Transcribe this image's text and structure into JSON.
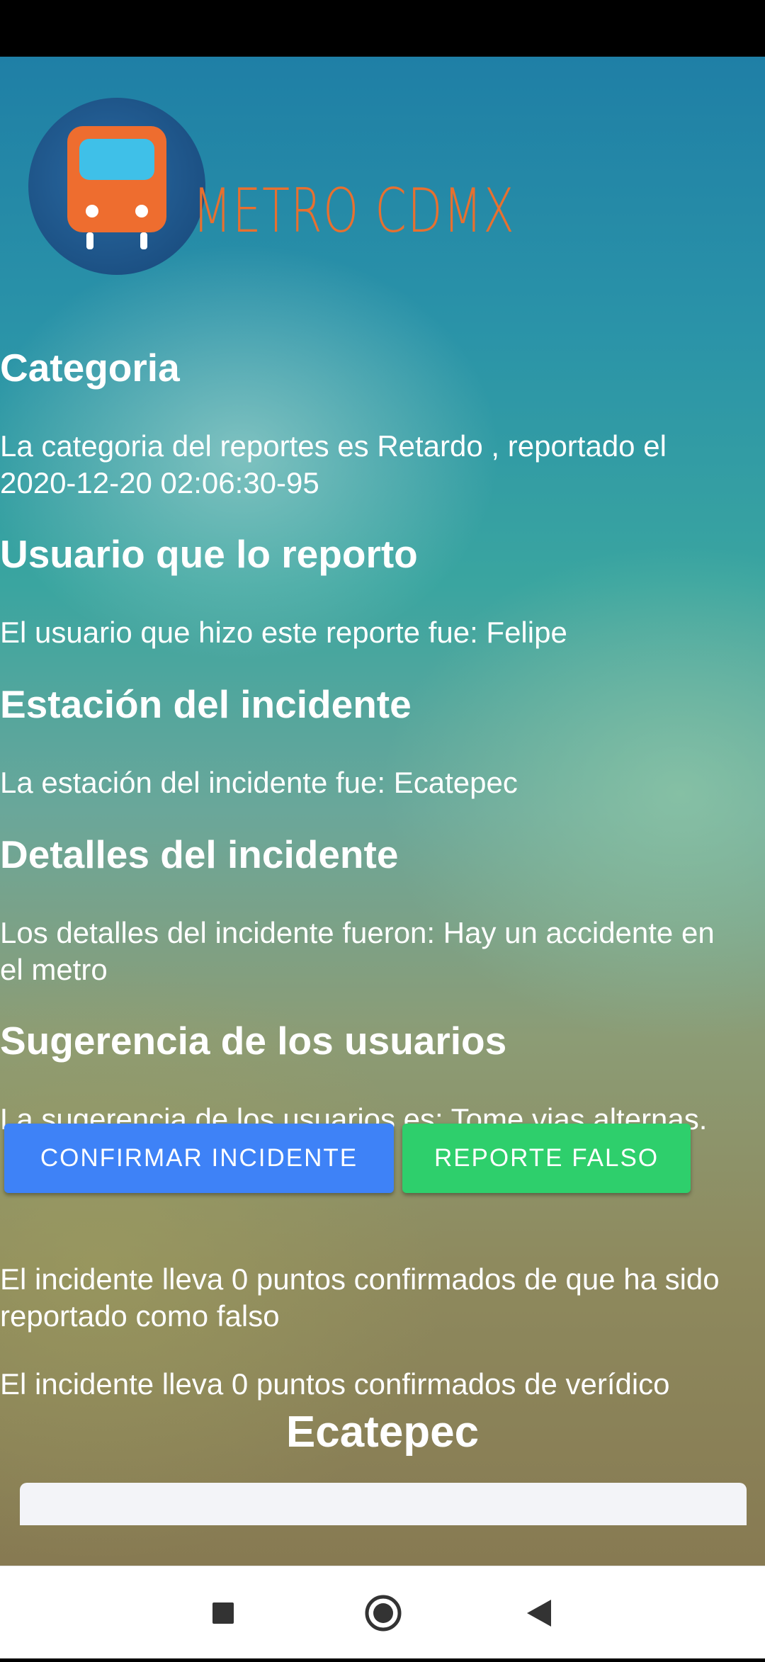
{
  "app": {
    "logo_text": "METRO CDMX"
  },
  "sections": {
    "categoria": {
      "heading": "Categoria",
      "line1": "La categoria del reportes es Retardo , reportado el",
      "line2": "2020-12-20 02:06:30-95"
    },
    "usuario": {
      "heading": "Usuario que lo reporto",
      "text": "El usuario que hizo este reporte fue: Felipe"
    },
    "estacion": {
      "heading": "Estación del incidente",
      "text": "La estación del incidente fue: Ecatepec"
    },
    "detalles": {
      "heading": "Detalles del incidente",
      "line1": "Los detalles del incidente fueron: Hay un accidente en",
      "line2": "el metro"
    },
    "sugerencia": {
      "heading": "Sugerencia de los usuarios",
      "text": "La sugerencia de los usuarios es: Tome vias alternas."
    }
  },
  "buttons": {
    "confirm_label": "CONFIRMAR INCIDENTE",
    "false_label": "REPORTE FALSO"
  },
  "counts": {
    "false_line1": "El incidente lleva 0 puntos confirmados de que ha sido",
    "false_line2": "reportado como falso",
    "true_line": "El incidente lleva 0 puntos confirmados de verídico"
  },
  "station_title": "Ecatepec",
  "colors": {
    "confirm_button": "#3e82f7",
    "false_button": "#2ecf6c",
    "logo_orange": "#e8702f",
    "logo_circle": "#1b4f82"
  },
  "nav": {
    "recents_icon": "square-icon",
    "home_icon": "circle-home-icon",
    "back_icon": "triangle-back-icon"
  }
}
